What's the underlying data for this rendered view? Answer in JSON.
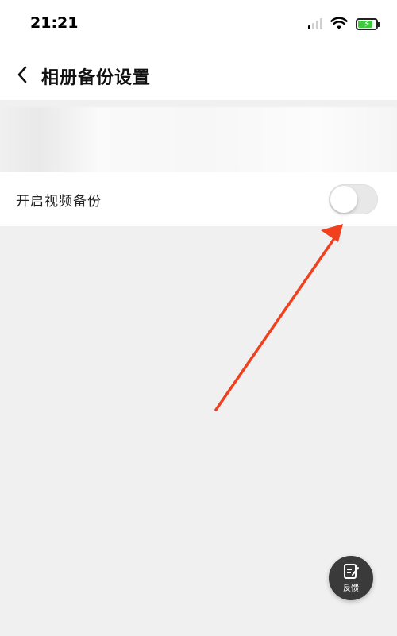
{
  "status_bar": {
    "time": "21:21",
    "icons": [
      "cellular-signal-icon",
      "wifi-icon",
      "battery-charging-icon"
    ],
    "battery_color": "#3cc93c"
  },
  "header": {
    "title": "相册备份设置",
    "back_icon": "chevron-left-icon"
  },
  "settings": {
    "video_backup_label": "开启视频备份",
    "video_backup_enabled": false
  },
  "feedback": {
    "label": "反馈",
    "icon": "edit-note-icon"
  },
  "annotation": {
    "color": "#f0401e",
    "icon": "arrow-icon"
  }
}
